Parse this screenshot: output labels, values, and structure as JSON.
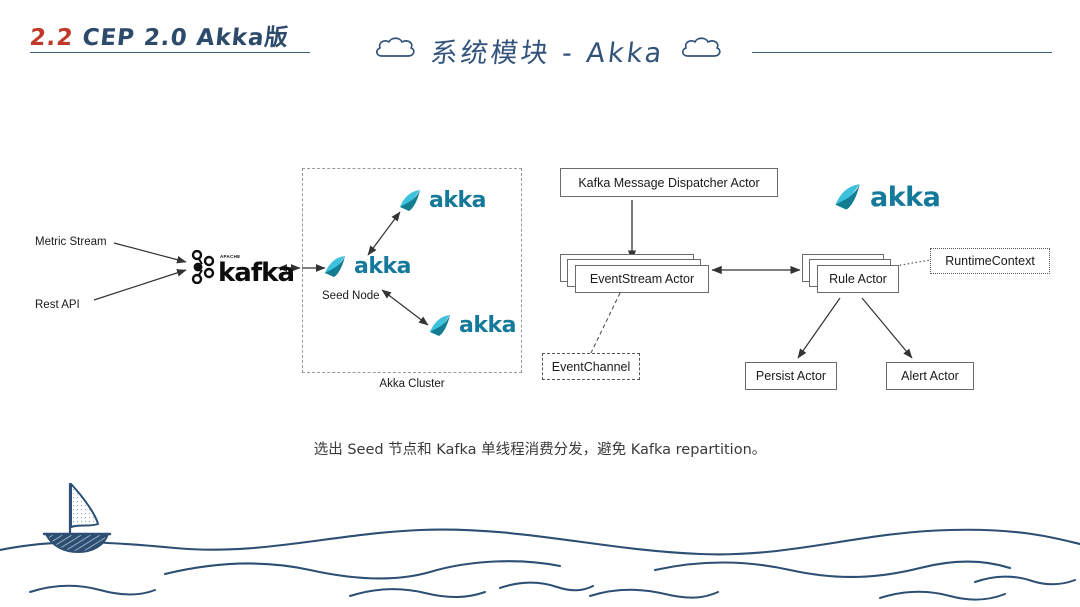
{
  "header": {
    "section_number": "2.2",
    "section_title": "CEP 2.0 Akka版",
    "main_title": "系统模块 - Akka",
    "cloud_icon_left": "cloud-icon",
    "cloud_icon_right": "cloud-icon",
    "rule_color": "#3d5f84",
    "number_color": "#c0392b",
    "title_color": "#2d4a6b"
  },
  "diagram": {
    "inputs": [
      {
        "label": "Metric Stream"
      },
      {
        "label": "Rest API"
      }
    ],
    "kafka": {
      "apache_label": "APACHE",
      "word": "kafka",
      "icon": "kafka-logo-icon"
    },
    "cluster": {
      "caption": "Akka Cluster",
      "seed_label": "Seed Node",
      "nodes": [
        {
          "word": "akka"
        },
        {
          "word": "akka"
        },
        {
          "word": "akka"
        }
      ]
    },
    "akka_standalone": {
      "word": "akka"
    },
    "actors": {
      "dispatcher": "Kafka Message Dispatcher Actor",
      "event_stream": "EventStream Actor",
      "event_channel": "EventChannel",
      "rule": "Rule Actor",
      "runtime_context": "RuntimeContext",
      "persist": "Persist Actor",
      "alert": "Alert Actor"
    },
    "colors": {
      "akka_light": "#2ab7d4",
      "akka_dark": "#157d92",
      "akka_text": "#15799a",
      "box_border": "#6b6b6b",
      "arrow": "#333333",
      "cluster_border": "#9a9a9a"
    }
  },
  "caption": {
    "text": "选出 Seed 节点和 Kafka 单线程消费分发，避免 Kafka repartition。"
  },
  "footer": {
    "boat_icon": "sailboat-icon",
    "wave_icon": "wave-lines-icon",
    "ink_color": "#2d4f73",
    "sail_fill": "#eaf0f7",
    "hull_fill": "#2d4f73"
  }
}
